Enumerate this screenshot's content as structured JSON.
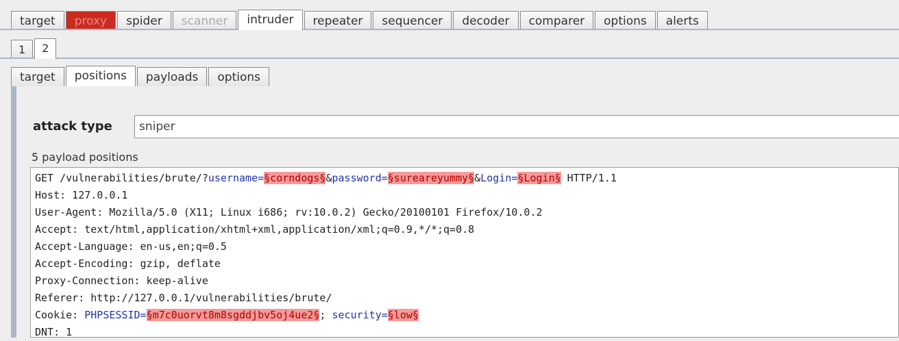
{
  "top_tabs": [
    "target",
    "proxy",
    "spider",
    "scanner",
    "intruder",
    "repeater",
    "sequencer",
    "decoder",
    "comparer",
    "options",
    "alerts"
  ],
  "num_tabs": [
    "1",
    "2"
  ],
  "sub_tabs": [
    "target",
    "positions",
    "payloads",
    "options"
  ],
  "attack": {
    "label": "attack type",
    "value": "sniper"
  },
  "positions_count": "5 payload positions",
  "request": {
    "l1": {
      "a": "GET /vulnerabilities/brute/?",
      "k1": "username",
      "eq1": "=",
      "m1": "§corndogs§",
      "amp1": "&",
      "k2": "password",
      "eq2": "=",
      "m2": "§sureareyummy§",
      "amp2": "&",
      "k3": "Login",
      "eq3": "=",
      "m3": "§Login§",
      "tail": " HTTP/1.1"
    },
    "l2": "Host: 127.0.0.1",
    "l3": "User-Agent: Mozilla/5.0 (X11; Linux i686; rv:10.0.2) Gecko/20100101 Firefox/10.0.2",
    "l4": "Accept: text/html,application/xhtml+xml,application/xml;q=0.9,*/*;q=0.8",
    "l5": "Accept-Language: en-us,en;q=0.5",
    "l6": "Accept-Encoding: gzip, deflate",
    "l7": "Proxy-Connection: keep-alive",
    "l8": "Referer: http://127.0.0.1/vulnerabilities/brute/",
    "l9": {
      "a": "Cookie: ",
      "k1": "PHPSESSID",
      "eq1": "=",
      "m1": "§m7c0uorvt8m8sgddjbv5oj4ue2§",
      "sep": "; ",
      "k2": "security",
      "eq2": "=",
      "m2": "§low§"
    },
    "l10": "DNT: 1"
  }
}
